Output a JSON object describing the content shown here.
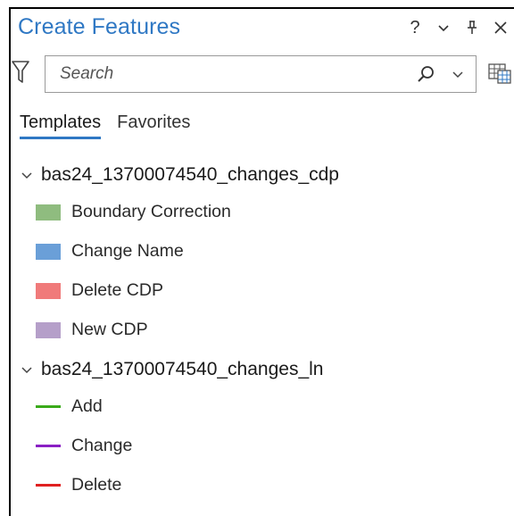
{
  "panel": {
    "title": "Create Features",
    "actions": {
      "help": "?"
    }
  },
  "search": {
    "placeholder": "Search",
    "value": ""
  },
  "tabs": [
    {
      "label": "Templates",
      "active": true
    },
    {
      "label": "Favorites",
      "active": false
    }
  ],
  "groups": [
    {
      "name": "bas24_13700074540_changes_cdp",
      "expanded": true,
      "items": [
        {
          "label": "Boundary Correction",
          "symbol": "polygon",
          "color": "#8fbc7f"
        },
        {
          "label": "Change Name",
          "symbol": "polygon",
          "color": "#6a9fd8"
        },
        {
          "label": "Delete CDP",
          "symbol": "polygon",
          "color": "#f07a7a"
        },
        {
          "label": "New CDP",
          "symbol": "polygon",
          "color": "#b59fc9"
        }
      ]
    },
    {
      "name": "bas24_13700074540_changes_ln",
      "expanded": true,
      "items": [
        {
          "label": "Add",
          "symbol": "line",
          "color": "#3aaa1a"
        },
        {
          "label": "Change",
          "symbol": "line",
          "color": "#8a1fc4"
        },
        {
          "label": "Delete",
          "symbol": "line",
          "color": "#e02020"
        }
      ]
    }
  ],
  "colors": {
    "accent": "#2f78c4",
    "border": "#000000"
  }
}
